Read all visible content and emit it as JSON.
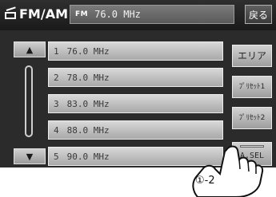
{
  "header": {
    "title": "FM/AM",
    "band_chip": "FM",
    "current_frequency": "76.0 MHz",
    "back_label": "戻る"
  },
  "presets": [
    {
      "number": "1",
      "frequency": "76.0 MHz"
    },
    {
      "number": "2",
      "frequency": "78.0 MHz"
    },
    {
      "number": "3",
      "frequency": "83.0 MHz"
    },
    {
      "number": "4",
      "frequency": "88.0 MHz"
    },
    {
      "number": "5",
      "frequency": "90.0 MHz"
    }
  ],
  "side_buttons": {
    "area": "エリア",
    "preset1": "ﾌﾟﾘｾｯﾄ1",
    "preset2": "ﾌﾟﾘｾｯﾄ2",
    "asel": "A.SEL"
  },
  "annotation": {
    "step": "①-2"
  },
  "icons": {
    "radio": "radio-icon",
    "scroll_up": "arrow-up-icon",
    "scroll_down": "arrow-down-icon",
    "pointer": "hand-pointer-icon"
  }
}
